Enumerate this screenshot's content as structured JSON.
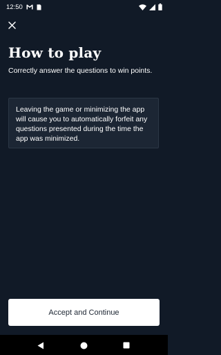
{
  "status_bar": {
    "time": "12:50",
    "icons": [
      "gmail-icon",
      "sim-card-icon",
      "wifi-icon",
      "signal-icon",
      "battery-icon"
    ]
  },
  "header": {
    "close_icon": "close-icon"
  },
  "main": {
    "title": "How to play",
    "subtitle": "Correctly answer the questions to win points.",
    "warning": "Leaving the game or minimizing the app will cause you to automatically forfeit any questions presented during the time the app was minimized."
  },
  "footer": {
    "accept_label": "Accept and Continue"
  },
  "nav_bar": {
    "icons": [
      "back-icon",
      "home-icon",
      "recents-icon"
    ]
  },
  "colors": {
    "background": "#111a27",
    "card": "#1c2634",
    "button": "#ffffff",
    "button_text": "#1c2532"
  }
}
